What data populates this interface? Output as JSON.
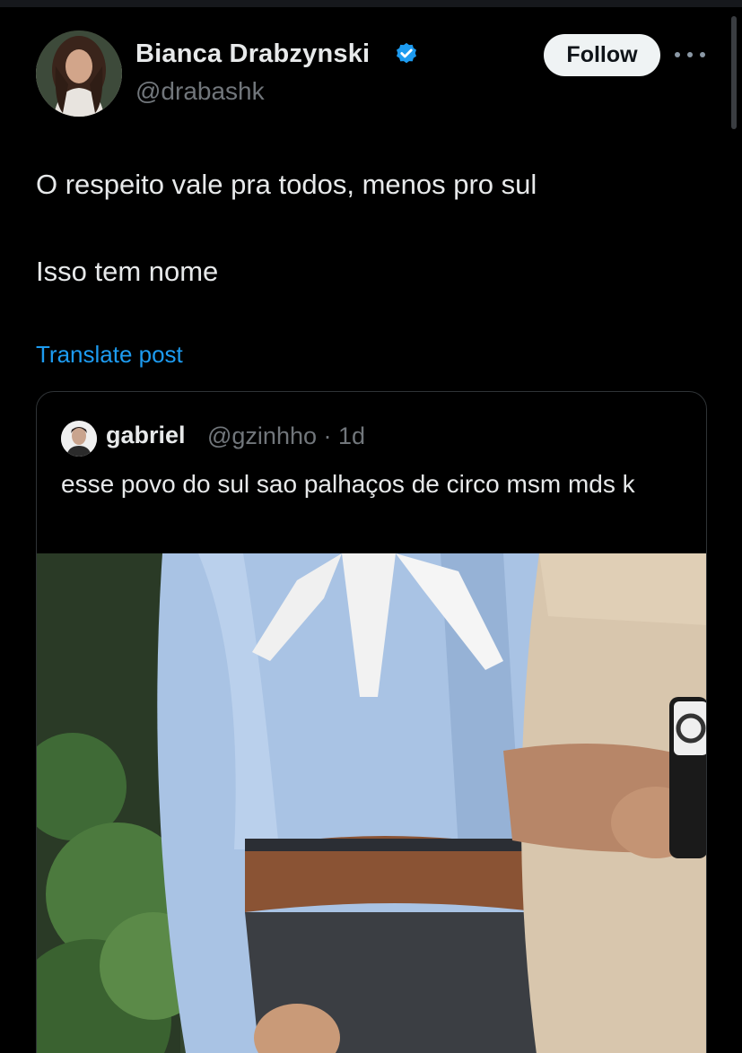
{
  "author": {
    "name": "Bianca Drabzynski",
    "handle": "@drabashk",
    "verified": true
  },
  "follow_label": "Follow",
  "post": {
    "line1": "O respeito vale pra todos, menos pro sul",
    "line2": "Isso tem nome"
  },
  "translate_label": "Translate post",
  "quoted": {
    "name": "gabriel",
    "handle_time": "@gzinhho · 1d",
    "text": "esse povo do sul sao palhaços de circo msm mds k"
  },
  "icons": {
    "verified": "verified-badge-icon",
    "more": "more-dots-icon"
  },
  "colors": {
    "background": "#000000",
    "link": "#1d9bf0",
    "verified": "#1d9bf0",
    "muted": "#71767b"
  }
}
